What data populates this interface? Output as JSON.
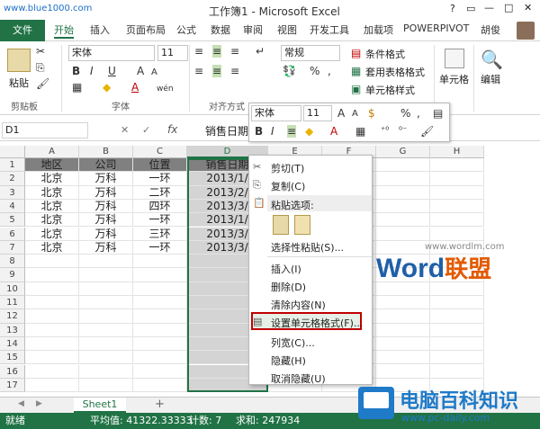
{
  "watermark_url": "www.blue1000.com",
  "window": {
    "title": "工作簿1 - Microsoft Excel",
    "help": "?",
    "min": "—",
    "max": "□",
    "close": "✕"
  },
  "tabs": {
    "file": "文件",
    "items": [
      "开始",
      "插入",
      "页面布局",
      "公式",
      "数据",
      "审阅",
      "视图",
      "开发工具",
      "加载项",
      "POWERPIVOT"
    ],
    "user": "胡俊"
  },
  "ribbon": {
    "clipboard": {
      "label": "剪贴板",
      "paste": "粘贴"
    },
    "font": {
      "label": "字体",
      "name": "宋体",
      "size": "11",
      "bold": "B",
      "italic": "I",
      "underline": "U",
      "grow": "A",
      "shrink": "A",
      "font_color": "A",
      "wen": "wén"
    },
    "align": {
      "label": "对齐方式"
    },
    "number": {
      "format": "常规",
      "percent": "%",
      "comma": ","
    },
    "styles": {
      "cond": "条件格式",
      "table": "套用表格格式",
      "cell": "单元格样式"
    },
    "cells": {
      "label": "单元格"
    },
    "edit": {
      "label": "编辑"
    }
  },
  "formula": {
    "namebox": "D1",
    "cancel": "✕",
    "enter": "✓",
    "fx": "fx",
    "content": "销售日期"
  },
  "grid": {
    "columns": [
      "A",
      "B",
      "C",
      "D",
      "E",
      "F",
      "G",
      "H"
    ],
    "rows": [
      "1",
      "2",
      "3",
      "4",
      "5",
      "6",
      "7",
      "8",
      "9",
      "10",
      "11",
      "12",
      "13",
      "14",
      "15",
      "16",
      "17"
    ],
    "data": [
      [
        "地区",
        "公司",
        "位置",
        "销售日期"
      ],
      [
        "北京",
        "万科",
        "一环",
        "2013/1/"
      ],
      [
        "北京",
        "万科",
        "二环",
        "2013/2/"
      ],
      [
        "北京",
        "万科",
        "四环",
        "2013/3/"
      ],
      [
        "北京",
        "万科",
        "一环",
        "2013/1/"
      ],
      [
        "北京",
        "万科",
        "三环",
        "2013/3/"
      ],
      [
        "北京",
        "万科",
        "一环",
        "2013/3/"
      ]
    ]
  },
  "sheet": {
    "tab": "Sheet1",
    "add": "+"
  },
  "status": {
    "ready": "就绪",
    "average": "平均值: 41322.33333",
    "count": "计数: 7",
    "sum": "求和: 247934"
  },
  "minitoolbar": {
    "font": "宋体",
    "size": "11",
    "bold": "B",
    "italic": "I",
    "percent": "%",
    "comma": ","
  },
  "contextmenu": {
    "cut": "剪切(T)",
    "copy": "复制(C)",
    "paste_options": "粘贴选项:",
    "paste_special": "选择性粘贴(S)...",
    "insert": "插入(I)",
    "delete": "删除(D)",
    "clear": "清除内容(N)",
    "format_cells": "设置单元格格式(F)...",
    "col_width": "列宽(C)...",
    "hide": "隐藏(H)",
    "unhide": "取消隐藏(U)"
  },
  "brand_wm": {
    "word": "Word",
    "lianmeng": "联盟",
    "url": "www.wordlm.com"
  },
  "brand_pc": {
    "name": "电脑百科知识",
    "url": "www.pc-daily.com"
  },
  "colors": {
    "excel_green": "#217346",
    "selection": "#d4d4d4",
    "highlight": "#c00000"
  }
}
